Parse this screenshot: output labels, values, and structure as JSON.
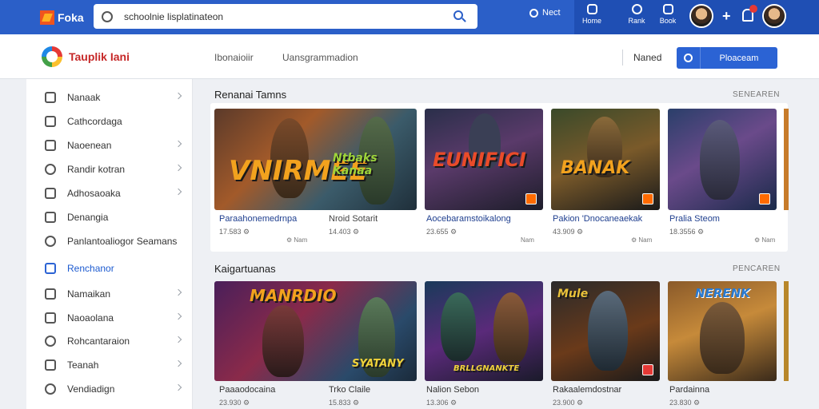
{
  "topbar": {
    "logo_text": "Foka",
    "search_value": "schoolnie lisplatinateon",
    "pill_label": "Nect",
    "icons": [
      {
        "name": "home-icon",
        "label": "Home"
      },
      {
        "name": "rank-icon",
        "label": "Rank"
      },
      {
        "name": "rank-icon-2",
        "label": "Book"
      }
    ],
    "accent": "#2b5fc8"
  },
  "subheader": {
    "brand_text": "Tauplik Iani",
    "nav": [
      "Ibonaioiir",
      "Uansgrammadion"
    ],
    "label": "Naned",
    "button_label": "Ploaceam"
  },
  "sidebar": {
    "items": [
      {
        "label": "Nanaak",
        "icon": "home-icon",
        "chevron": true
      },
      {
        "label": "Cathcordaga",
        "icon": "category-icon",
        "chevron": false
      },
      {
        "label": "Naoenean",
        "icon": "square-icon",
        "chevron": true
      },
      {
        "label": "Randir kotran",
        "icon": "heart-icon",
        "chevron": true
      },
      {
        "label": "Adhosaoaka",
        "icon": "list-icon",
        "chevron": true
      },
      {
        "label": "Denangia",
        "icon": "puzzle-icon",
        "chevron": false
      },
      {
        "label": "Panlantoaliogor Seamans",
        "icon": "clock-icon",
        "chevron": false
      },
      {
        "label": "Renchanor",
        "icon": "grid-icon",
        "chevron": false,
        "active": true
      },
      {
        "label": "Namaikan",
        "icon": "tag-icon",
        "chevron": true
      },
      {
        "label": "Naoaolana",
        "icon": "box-icon",
        "chevron": true
      },
      {
        "label": "Rohcantaraion",
        "icon": "circle-icon",
        "chevron": true
      },
      {
        "label": "Teanah",
        "icon": "flag-icon",
        "chevron": true
      },
      {
        "label": "Vendiadign",
        "icon": "search-icon",
        "chevron": true
      }
    ]
  },
  "sections": [
    {
      "title": "Renanai Tamns",
      "link": "SENEAREN",
      "cards": [
        {
          "title": "Paraahonemedrnpa",
          "meta": "17.583 ⚙",
          "right": "⚙ Nam",
          "title2": "Nroid Sotarit",
          "meta2": "14.403 ⚙",
          "art": "VNIRMEE"
        },
        {
          "title": "Aocebaramstoikalong",
          "meta": "23.655 ⚙",
          "right": "Nam",
          "art": "EUNIFICI"
        },
        {
          "title": "Pakion 'Dnocaneaekak",
          "meta": "43.909 ⚙",
          "right": "⚙ Nam",
          "art": "BANAK"
        },
        {
          "title": "Pralia Steom",
          "meta": "18.3556 ⚙",
          "right": "⚙ Nam",
          "art": ""
        }
      ]
    },
    {
      "title": "Kaigartuanas",
      "link": "PENCAREN",
      "cards": [
        {
          "title": "Paaaodocaina",
          "meta": "23.930 ⚙",
          "title2": "Trko Claile",
          "meta2": "15.833 ⚙",
          "art": "MANRDIO"
        },
        {
          "title": "Nalion Sebon",
          "meta": "13.306 ⚙",
          "art": ""
        },
        {
          "title": "Rakaalemdostnar",
          "meta": "23.900 ⚙",
          "art": "Mule"
        },
        {
          "title": "Pardainna",
          "meta": "23.830 ⚙",
          "art": "NERENK"
        }
      ]
    }
  ]
}
